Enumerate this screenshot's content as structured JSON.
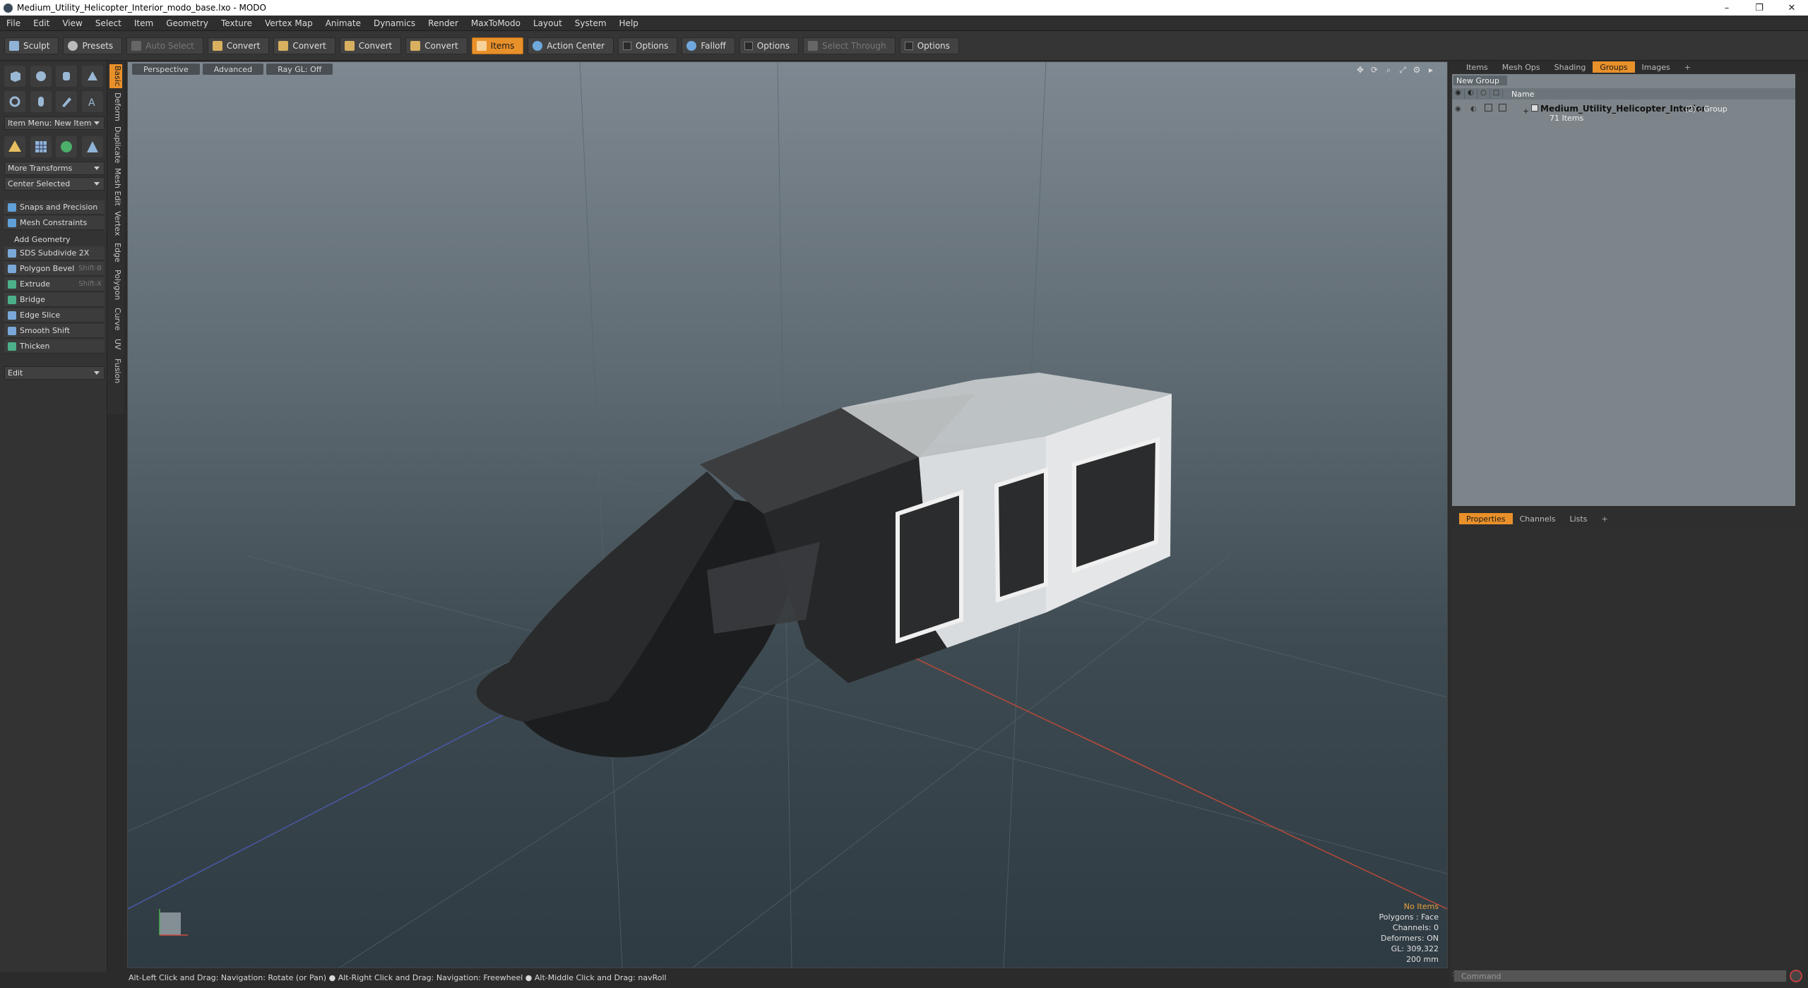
{
  "window": {
    "title": "Medium_Utility_Helicopter_Interior_modo_base.lxo - MODO",
    "controls": [
      "–",
      "❐",
      "✕"
    ]
  },
  "menu": [
    "File",
    "Edit",
    "View",
    "Select",
    "Item",
    "Geometry",
    "Texture",
    "Vertex Map",
    "Animate",
    "Dynamics",
    "Render",
    "MaxToModo",
    "Layout",
    "System",
    "Help"
  ],
  "toolbar": {
    "sculpt": "Sculpt",
    "presets": "Presets",
    "auto_select": "Auto Select",
    "convert1": "Convert",
    "convert2": "Convert",
    "convert3": "Convert",
    "convert4": "Convert",
    "items": "Items",
    "action_center": "Action Center",
    "options1": "Options",
    "falloff": "Falloff",
    "options2": "Options",
    "select_through": "Select Through",
    "options3": "Options"
  },
  "left_panel": {
    "item_menu": "Item Menu: New Item",
    "more_transforms": "More Transforms",
    "center_selected": "Center Selected",
    "snaps": "Snaps and Precision",
    "mesh_constraints": "Mesh Constraints",
    "add_geometry": "Add Geometry",
    "sds": "SDS Subdivide 2X",
    "polygon_bevel": "Polygon Bevel",
    "polygon_bevel_sc": "Shift-B",
    "extrude": "Extrude",
    "extrude_sc": "Shift-X",
    "bridge": "Bridge",
    "edge_slice": "Edge Slice",
    "smooth_shift": "Smooth Shift",
    "thicken": "Thicken",
    "edit": "Edit"
  },
  "vertical_tabs": [
    "Basic",
    "Deform",
    "Duplicate",
    "Mesh Edit",
    "Vertex",
    "Edge",
    "Polygon",
    "Curve",
    "UV",
    "Fusion"
  ],
  "viewport": {
    "tabs": [
      "Perspective",
      "Advanced",
      "Ray GL: Off"
    ],
    "info": {
      "no_items": "No Items",
      "polygons": "Polygons : Face",
      "channels": "Channels: 0",
      "deformers": "Deformers: ON",
      "gl": "GL: 309,322",
      "scale": "200 mm"
    }
  },
  "status": "Alt-Left Click and Drag: Navigation: Rotate (or Pan) ● Alt-Right Click and Drag: Navigation: Freewheel ● Alt-Middle Click and Drag: navRoll",
  "right_panel": {
    "tabs": [
      "Items",
      "Mesh Ops",
      "Shading",
      "Groups",
      "Images",
      "+"
    ],
    "new_group": "New Group",
    "col_name": "Name",
    "group_name": "Medium_Utility_Helicopter_Interior",
    "group_type": "(2) : Group",
    "group_count": "71 Items",
    "props_tabs": [
      "Properties",
      "Channels",
      "Lists",
      "+"
    ]
  },
  "command_placeholder": "Command",
  "colors": {
    "accent": "#e8902a",
    "viewport_top": "#7e8891",
    "viewport_bottom": "#2f3b42"
  }
}
